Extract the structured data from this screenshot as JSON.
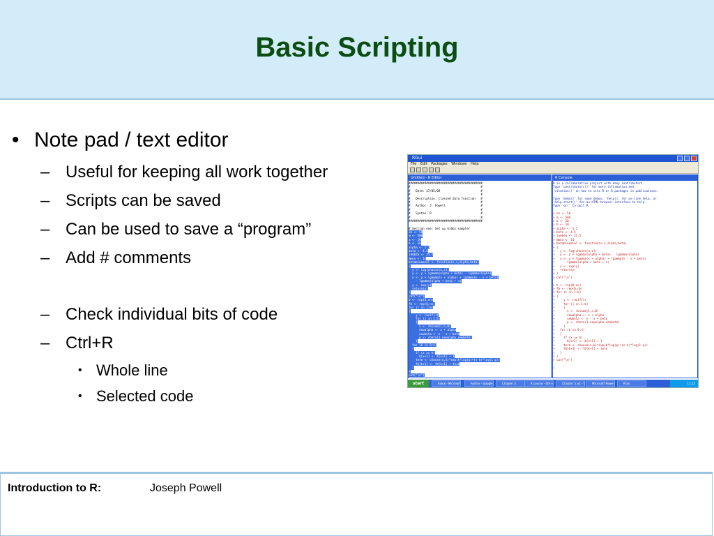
{
  "header": {
    "title": "Basic Scripting"
  },
  "bullets": {
    "main": "Note pad / text editor",
    "subs": [
      "Useful for keeping all work together",
      "Scripts can be saved",
      "Can be used to save a “program”",
      "Add # comments",
      "Check individual bits of code",
      "Ctrl+R"
    ],
    "subsubs": [
      "Whole line",
      "Selected code"
    ]
  },
  "screenshot": {
    "window_title": "RGui",
    "menu": [
      "File",
      "Edit",
      "Packages",
      "Windows",
      "Help"
    ],
    "editor_title": "Untitled - R Editor",
    "console_title": "R Console",
    "editor_lines": [
      "##########################################",
      "#                                        #",
      "#   Date: 27/05/09                       #",
      "#                                        #",
      "#   Description: Classed data function   #",
      "#                                        #",
      "#   Author: J. Powell                    #",
      "#                                        #",
      "#   Syntax: R                            #",
      "#                                        #",
      "##########################################",
      "",
      "# Section one: Set up Gibbs sampler",
      "nn <- 50",
      "m <- 500",
      "a <- 10",
      "b <- 10",
      "alpha <- 1.2",
      "beta <- 4.5",
      "lambda <- 25.5",
      "mmon <- 14",
      "betabinomial <- function(n,x,alpha,beta)",
      "{",
      "  y <- log(choose(n,x))",
      "  y <- y + lgamma(alpha + beta) - lgamma(alpha)",
      "  y <- y + lgamma(x + alpha) + lgamma(n - x + beta)",
      "    - lgamma(alpha + beta + n)",
      "  y <- exp(y)",
      "  return(y)",
      "}",
      "cat(\"\\n\")",
      "b <- rep(0,nn)",
      "fb <- rep(0,nn)",
      "for (i in 1:m)",
      "{",
      "    y <- runif(1)",
      "    for (j in 1:b)",
      "    {",
      "      x <- rbinom(1,n,0)",
      "      newalpha <- x + alpha",
      "      newbeta <- n - x + beta",
      "      p <- rbeta(1,newalpha,newbeta)",
      "    }",
      "  for (k in 0:n)",
      "  {",
      "    if (x == k)",
      "      b[x+1] <- b[x+1] + 1",
      "    term <- choose(n,k)*exp(k*log(p)+(n-k)*log(1-p))",
      "    fb[k+1] <- fb[k+1] + term",
      "  }",
      "}",
      "cat(\"\\n\")"
    ],
    "console_lines": [
      "R is a collaborative project with many contributors.",
      "Type 'contributors()' for more information and",
      "'citation()' on how to cite R or R packages in publications.",
      "",
      "Type 'demo()' for some demos, 'help()' for on-line help, or",
      "'help.start()' for an HTML browser interface to help.",
      "Type 'q()' to quit R.",
      "",
      "> nn <- 50",
      "> m <- 500",
      "> a <- 10",
      "> b <- 10",
      "> alpha <- 1.2",
      "> beta <- 4.5",
      "> lambda <- 25.5",
      "> mmon <- 14",
      "> betabinomial <- function(n,x,alpha,beta)",
      "+ {",
      "+   y <- log(choose(n,x))",
      "+   y <- y + lgamma(alpha + beta) - lgamma(alpha)",
      "+   y <- y + lgamma(x + alpha) + lgamma(n - x + beta)",
      "+     - lgamma(alpha + beta + n)",
      "+   y <- exp(y)",
      "+   return(y)",
      "+ }",
      "> cat(\"\\n\")",
      "",
      "> b <- rep(0,nn)",
      "> fb <- rep(0,nn)",
      "> for (i in 1:m)",
      "+ {",
      "+     y <- runif(1)",
      "+     for (j in 1:b)",
      "+     {",
      "+       x <- rbinom(1,n,0)",
      "+       newalpha <- x + alpha",
      "+       newbeta <- n - x + beta",
      "+       p <- rbeta(1,newalpha,newbeta)",
      "+     }",
      "+   for (k in 0:n)",
      "+   {",
      "+     if (x == k)",
      "+       b[x+1] <- b[x+1] + 1",
      "+     term <- choose(n,k)*exp(k*log(p)+(n-k)*log(1-p))",
      "+     fb[k+1] <- fb[k+1] + term",
      "+   }",
      "+ }",
      "> cat(\"\\n\")",
      "",
      "|"
    ],
    "taskbar": {
      "start": "start",
      "items": [
        "Inbox - Microsoft ...",
        "Author - Google Sc...",
        "Chapter 3",
        "R course - 4th ed.t",
        "Chapter 5_v2 - Mi...",
        "Microsoft PowerPo...",
        "RGui"
      ],
      "clock": "11:15"
    }
  },
  "footer": {
    "label": "Introduction to R:",
    "author": "Joseph Powell"
  },
  "colors": {
    "header_bg": "#d3ecfa",
    "title": "#0b4d12",
    "border": "#9cc5e4"
  }
}
